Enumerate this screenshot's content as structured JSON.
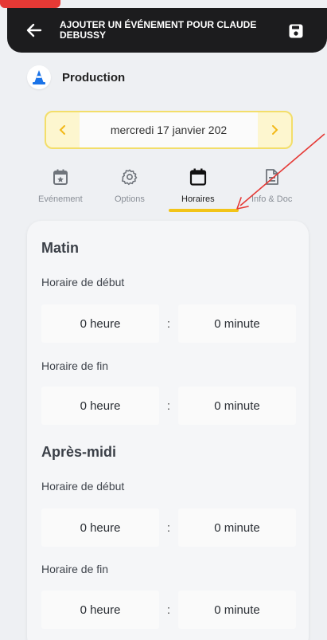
{
  "appbar": {
    "title": "AJOUTER UN ÉVÉNEMENT POUR CLAUDE DEBUSSY"
  },
  "production": {
    "label": "Production"
  },
  "date_picker": {
    "value": "mercredi 17 janvier 202"
  },
  "tabs": [
    {
      "label": "Evénement",
      "icon": "calendar-star-icon",
      "active": false
    },
    {
      "label": "Options",
      "icon": "gear-icon",
      "active": false
    },
    {
      "label": "Horaires",
      "icon": "calendar-icon",
      "active": true
    },
    {
      "label": "Info & Doc",
      "icon": "document-icon",
      "active": false
    }
  ],
  "schedule": {
    "morning": {
      "title": "Matin",
      "start": {
        "label": "Horaire de début",
        "hour": "0 heure",
        "minute": "0 minute"
      },
      "end": {
        "label": "Horaire de fin",
        "hour": "0 heure",
        "minute": "0 minute"
      }
    },
    "afternoon": {
      "title": "Après-midi",
      "start": {
        "label": "Horaire de début",
        "hour": "0 heure",
        "minute": "0 minute"
      },
      "end": {
        "label": "Horaire de fin",
        "hour": "0 heure",
        "minute": "0 minute"
      }
    },
    "separator": ":"
  },
  "colors": {
    "appbar": "#1c1c1e",
    "accent": "#f2c418",
    "date_bg": "#fdf6cf",
    "annotation": "#e53935"
  }
}
